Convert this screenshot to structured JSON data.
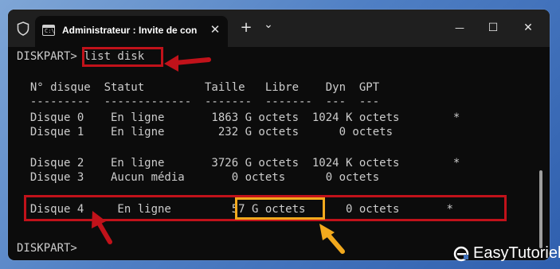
{
  "window": {
    "tab_title": "Administrateur : Invite de con",
    "tab_icon_glyph": "C:\\",
    "close_tab_glyph": "✕",
    "new_tab_glyph": "+",
    "dropdown_glyph": "⌄",
    "minimize_glyph": "—",
    "maximize_glyph": "☐",
    "close_glyph": "✕"
  },
  "terminal": {
    "command_line": "DISKPART> list disk",
    "header": "  N° disque  Statut         Taille   Libre    Dyn  GPT",
    "separator": "  ---------  -------------  -------  -------  ---  ---",
    "disks": [
      {
        "line": "  Disque 0    En ligne       1863 G octets  1024 K octets        *"
      },
      {
        "line": "  Disque 1    En ligne        232 G octets      0 octets"
      },
      {
        "line": "  Disque 2    En ligne       3726 G octets  1024 K octets        *"
      },
      {
        "line": "  Disque 3    Aucun média       0 octets      0 octets"
      },
      {
        "line": "  Disque 4     En ligne         57 G octets      0 octets       *"
      }
    ],
    "prompt_end": "DISKPART> "
  },
  "watermark": {
    "brand": "EasyTutoriel"
  },
  "colors": {
    "highlight_red": "#c1121a",
    "highlight_orange": "#f2a91d",
    "terminal_bg": "#0c0c0c",
    "terminal_fg": "#cccccc"
  }
}
